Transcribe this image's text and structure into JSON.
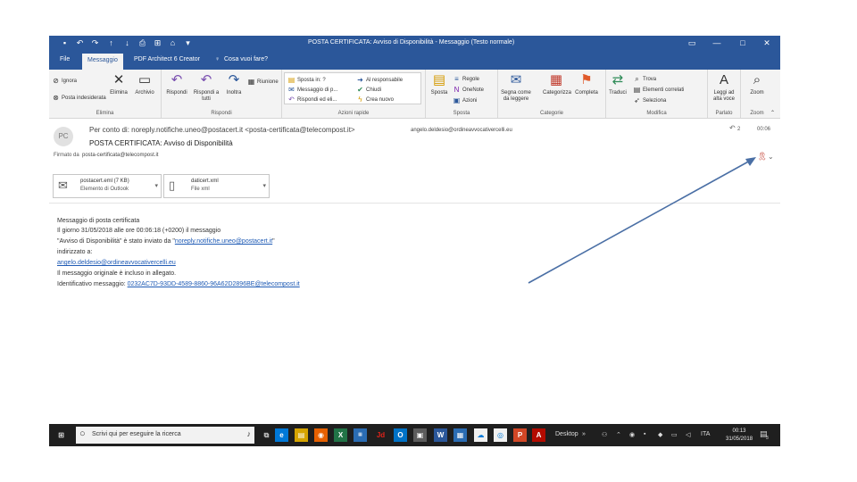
{
  "window": {
    "title": "POSTA CERTIFICATA: Avviso di Disponibilità  -  Messaggio (Testo normale)"
  },
  "tabs": [
    "File",
    "Messaggio",
    "PDF Architect 6 Creator",
    "Cosa vuoi fare?"
  ],
  "ribbon": {
    "elimina": {
      "label": "Elimina",
      "ignore": "Ignora",
      "junk": "Posta indesiderata",
      "delete": "Elimina",
      "archive": "Archivio"
    },
    "rispondi": {
      "label": "Rispondi",
      "reply": "Rispondi",
      "reply_all": "Rispondi a tutti",
      "forward": "Inoltra",
      "meeting": "Riunione"
    },
    "quick_steps": {
      "label": "Azioni rapide",
      "items": [
        "Sposta in: ?",
        "Al responsabile",
        "Messaggio di p...",
        "Chiudi",
        "Rispondi ed eli...",
        "Crea nuovo"
      ]
    },
    "sposta": {
      "label": "Sposta",
      "move": "Sposta",
      "rules": "Regole",
      "onenote": "OneNote",
      "actions": "Azioni"
    },
    "categorie": {
      "label": "Categorie",
      "mark_unread": "Segna come da leggere",
      "categorize": "Categorizza",
      "followup": "Completa"
    },
    "modifica": {
      "label": "Modifica",
      "translate": "Traduci",
      "find": "Trova",
      "related": "Elementi correlati",
      "select": "Seleziona"
    },
    "parlato": {
      "label": "Parlato",
      "read_aloud": "Leggi ad alta voce"
    },
    "zoom": {
      "label": "Zoom",
      "zoom": "Zoom"
    }
  },
  "message": {
    "avatar": "PC",
    "from": "Per conto di: noreply.notifiche.uneo@postacert.it <posta-certificata@telecompost.it>",
    "recipient": "angelo.deldesio@ordineavvocativercelli.eu",
    "subject": "POSTA CERTIFICATA: Avviso di Disponibilità",
    "signed_label": "Firmato da",
    "signed_by": "posta-certificata@telecompost.it",
    "reply_count": "2",
    "time": "00:06"
  },
  "attachments": [
    {
      "name": "postacert.eml (7 KB)",
      "type": "Elemento di Outlook"
    },
    {
      "name": "daticert.xml",
      "type": "File xml"
    }
  ],
  "body": {
    "line1": "Messaggio di posta certificata",
    "line2": "Il giorno 31/05/2018 alle ore 00:06:18 (+0200) il messaggio",
    "line3_pre": "\"Avviso di Disponibilità\" è stato inviato da \"",
    "line3_link": "noreply.notifiche.uneo@postacert.it",
    "line3_post": "\"",
    "line4": "indirizzato a:",
    "line5_link": "angelo.deldesio@ordineavvocativercelli.eu",
    "line6": "Il messaggio originale è incluso in allegato.",
    "line7_pre": "Identificativo messaggio: ",
    "line7_link": "0232AC7D-93DD-4589-8860-96A62D2896BE@telecompost.it"
  },
  "taskbar": {
    "search_placeholder": "Scrivi qui per eseguire la ricerca",
    "desktop": "Desktop",
    "lang": "ITA",
    "time": "00:13",
    "date": "31/05/2018",
    "notification_count": "3"
  },
  "colors": {
    "outlook_blue": "#2b579a",
    "link": "#1f5bb5",
    "arrow": "#4a6fa5",
    "taskbar": "#1f1f1f"
  }
}
